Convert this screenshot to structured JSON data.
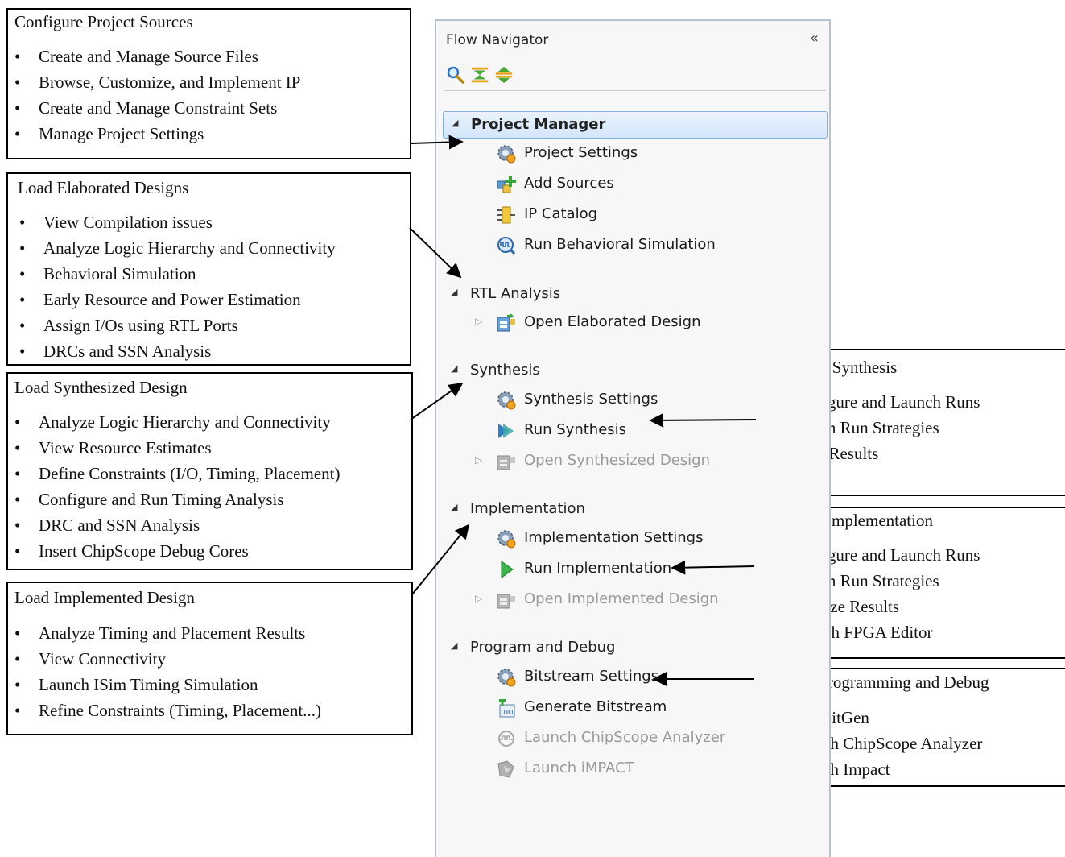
{
  "panel": {
    "title": "Flow Navigator",
    "collapse_label": "«",
    "toolbar": [
      "search-icon",
      "collapse-all-icon",
      "expand-all-icon"
    ],
    "sections": [
      {
        "label": "Project Manager",
        "active": true,
        "items": [
          {
            "label": "Project Settings",
            "icon": "settings-gear-icon",
            "disabled": false
          },
          {
            "label": "Add Sources",
            "icon": "add-sources-icon",
            "disabled": false
          },
          {
            "label": "IP Catalog",
            "icon": "ip-chip-icon",
            "disabled": false
          },
          {
            "label": "Run Behavioral Simulation",
            "icon": "waveform-icon",
            "disabled": false
          }
        ]
      },
      {
        "label": "RTL Analysis",
        "active": false,
        "items": [
          {
            "label": "Open Elaborated Design",
            "icon": "open-design-icon",
            "disabled": false,
            "expandable": true
          }
        ]
      },
      {
        "label": "Synthesis",
        "active": false,
        "items": [
          {
            "label": "Synthesis Settings",
            "icon": "settings-gear-icon",
            "disabled": false
          },
          {
            "label": "Run Synthesis",
            "icon": "synthesis-icon",
            "disabled": false
          },
          {
            "label": "Open Synthesized Design",
            "icon": "open-design-icon",
            "disabled": true,
            "expandable": true
          }
        ]
      },
      {
        "label": "Implementation",
        "active": false,
        "items": [
          {
            "label": "Implementation Settings",
            "icon": "settings-gear-icon",
            "disabled": false
          },
          {
            "label": "Run Implementation",
            "icon": "play-icon",
            "disabled": false
          },
          {
            "label": "Open Implemented Design",
            "icon": "open-design-icon",
            "disabled": true,
            "expandable": true
          }
        ]
      },
      {
        "label": "Program and Debug",
        "active": false,
        "items": [
          {
            "label": "Bitstream Settings",
            "icon": "settings-gear-icon",
            "disabled": false
          },
          {
            "label": "Generate Bitstream",
            "icon": "bitstream-icon",
            "disabled": false
          },
          {
            "label": "Launch ChipScope Analyzer",
            "icon": "chipscope-icon",
            "disabled": true
          },
          {
            "label": "Launch iMPACT",
            "icon": "impact-icon",
            "disabled": true
          }
        ]
      }
    ]
  },
  "callouts": {
    "project_sources": {
      "title": "Configure Project Sources",
      "items": [
        "Create and Manage Source Files",
        "Browse, Customize, and Implement IP",
        "Create and Manage Constraint Sets",
        "Manage Project Settings"
      ]
    },
    "elaborated": {
      "title": "Load Elaborated Designs",
      "items": [
        "View Compilation issues",
        "Analyze Logic Hierarchy and Connectivity",
        "Behavioral Simulation",
        "Early Resource and Power Estimation",
        "Assign I/Os using RTL Ports",
        "DRCs and SSN Analysis"
      ]
    },
    "synthesized": {
      "title": "Load Synthesized Design",
      "items": [
        "Analyze Logic Hierarchy and Connectivity",
        "View Resource Estimates",
        "Define Constraints (I/O, Timing, Placement)",
        "Configure and Run Timing Analysis",
        "DRC and SSN Analysis",
        "Insert ChipScope Debug Cores"
      ]
    },
    "implemented": {
      "title": "Load Implemented Design",
      "items": [
        "Analyze Timing and Placement Results",
        "View Connectivity",
        "Launch ISim Timing Simulation",
        "Refine Constraints (Timing, Placement...)"
      ]
    },
    "xst": {
      "title": "Run XST Synthesis",
      "items": [
        "Configure and Launch Runs",
        "Assign Run Strategies",
        "View Results"
      ]
    },
    "ise": {
      "title": "Run ISE Implementation",
      "items": [
        "Configure and Launch Runs",
        "Assign Run Strategies",
        "Analyze Results",
        "Launch FPGA Editor"
      ]
    },
    "programming": {
      "title": "Launch Programming and Debug",
      "items": [
        "Run BitGen",
        "Launch ChipScope Analyzer",
        "Launch Impact"
      ]
    }
  }
}
